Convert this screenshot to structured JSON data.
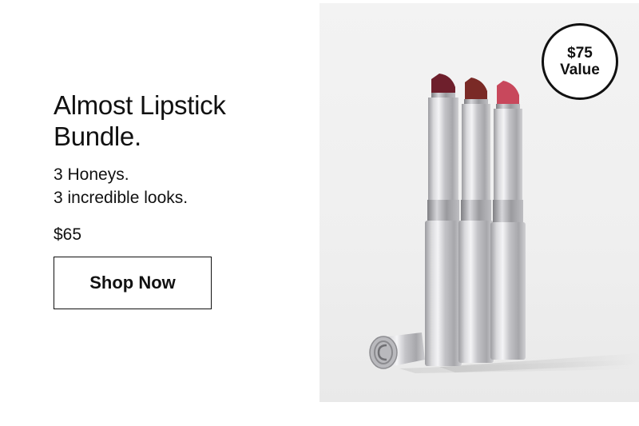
{
  "promo": {
    "title_line1": "Almost Lipstick",
    "title_line2": "Bundle.",
    "subtitle_line1": "3 Honeys.",
    "subtitle_line2": "3 incredible looks.",
    "price": "$65",
    "cta_label": "Shop Now",
    "badge_line1": "$75",
    "badge_line2": "Value"
  },
  "product_image": {
    "lipstick_shades": [
      "#6e1f2c",
      "#7a2a26",
      "#c8485c"
    ],
    "case_color": "#c9c9cc",
    "background": "#f1f1f1"
  }
}
